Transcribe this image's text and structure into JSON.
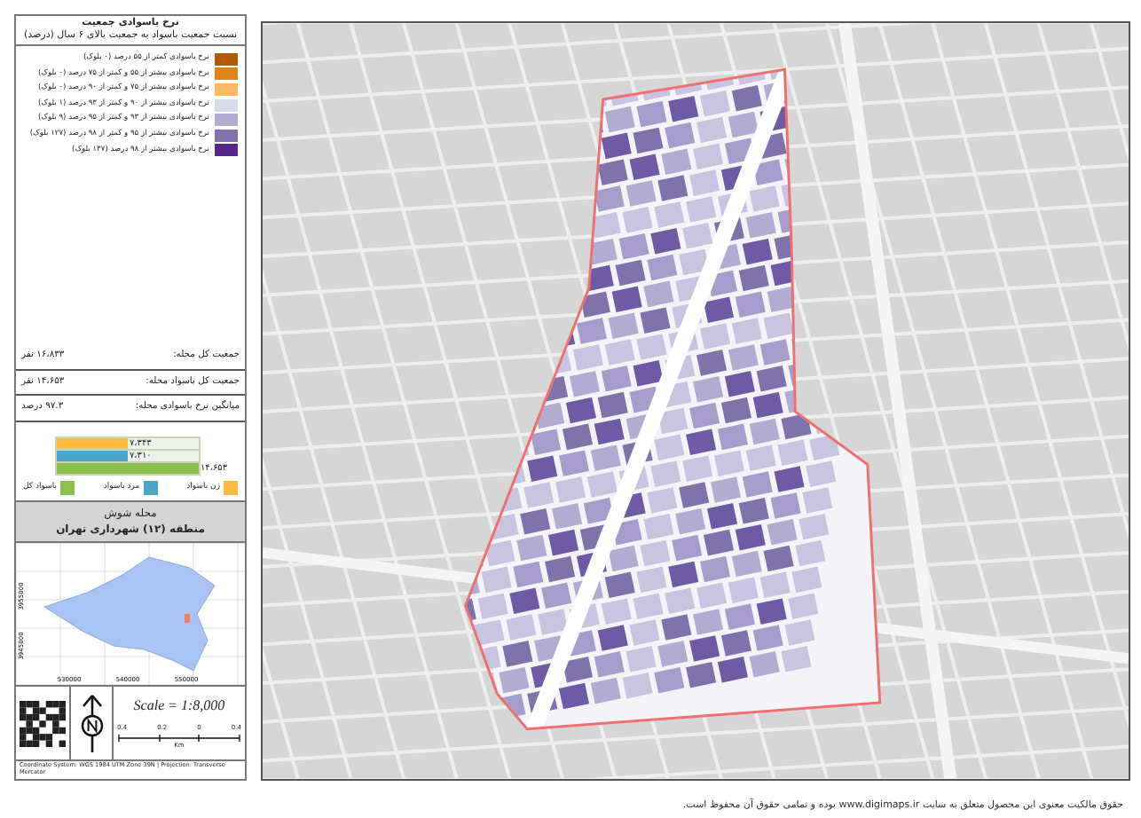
{
  "legend": {
    "title": "نرخ باسوادی جمعیت",
    "subtitle": "نسبت جمعیت باسواد به جمعیت بالای ۶ سال (درصد)",
    "items": [
      {
        "label": "نرخ باسوادی کمتر از ۵۵ درصد (۰ بلوک)",
        "color": "#b35806"
      },
      {
        "label": "نرخ باسوادی بیشتر از ۵۵ و کمتر از ۷۵ درصد (۰ بلوک)",
        "color": "#e08214"
      },
      {
        "label": "نرخ باسوادی بیشتر از ۷۵ و کمتر از ۹۰ درصد (۰ بلوک)",
        "color": "#fdb863"
      },
      {
        "label": "نرخ باسوادی بیشتر از ۹۰ و کمتر از ۹۳ درصد (۱ بلوک)",
        "color": "#d8daeb"
      },
      {
        "label": "نرخ باسوادی بیشتر از ۹۳ و کمتر از ۹۵ درصد (۹ بلوک)",
        "color": "#b2abd2"
      },
      {
        "label": "نرخ باسوادی بیشتر از ۹۵ و کمتر از ۹۸ درصد (۱۲۷ بلوک)",
        "color": "#8073ac"
      },
      {
        "label": "نرخ باسوادی بیشتر از ۹۸ درصد (۱۳۷ بلوک)",
        "color": "#542788"
      }
    ]
  },
  "stats": [
    {
      "label": "جمعیت کل محله:",
      "value": "۱۶،۸۳۳ نفر"
    },
    {
      "label": "جمعیت کل باسواد محله:",
      "value": "۱۴،۶۵۳ نفر"
    },
    {
      "label": "میانگین نرخ باسوادی محله:",
      "value": "۹۷.۳ درصد"
    }
  ],
  "literacy_bars": [
    {
      "name": "زن باسواد",
      "color": "#fbb93f",
      "level": 0.5,
      "value": "۷،۳۴۳"
    },
    {
      "name": "مرد باسواد",
      "color": "#4aa6c4",
      "level": 0.5,
      "value": "۷،۳۱۰"
    },
    {
      "name": "باسواد کل",
      "color": "#8cc04a",
      "level": 1,
      "value": "۱۴،۶۵۳"
    }
  ],
  "area": {
    "name": "محله شوش",
    "region": "منطقه (۱۲) شهرداری تهران"
  },
  "inset_map": {
    "xticks": [
      "550000",
      "540000",
      "530000"
    ],
    "yticks": [
      "3955000",
      "3945000"
    ]
  },
  "scale": {
    "text": "Scale = 1:8,000",
    "ticks": [
      "0.4",
      "0",
      "0.2",
      "0.4"
    ],
    "unit": "Km"
  },
  "coordinates": "Coordinate System: WGS 1984 UTM Zone 39N | Projection: Transverse Mercator",
  "copyright": "حقوق مالکیت معنوی این محصول متعلق به سایت www.digimaps.ir بوده و تمامی حقوق آن محفوظ است."
}
